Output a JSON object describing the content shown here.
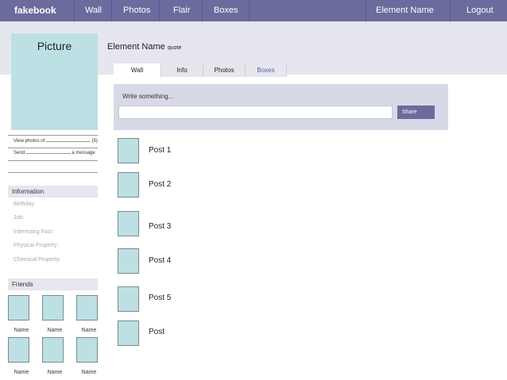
{
  "nav": {
    "logo": "fakebook",
    "wall": "Wall",
    "photos": "Photos",
    "flair": "Flair",
    "boxes": "Boxes",
    "element_name": "Element Name",
    "logout": "Logout"
  },
  "profile": {
    "picture_label": "Picture",
    "view_photos_prefix": "View photos of",
    "view_photos_count": "(5)",
    "send_prefix": "Send",
    "send_suffix": "a message"
  },
  "information": {
    "heading": "Information",
    "birthday": "Birthday:",
    "job": "Job:",
    "interesting_fact": "Interesting Fact:",
    "physical_property": "Physical Property:",
    "chemical_property": "Chemical Property:"
  },
  "friends": {
    "heading": "Friends",
    "names": [
      "Name",
      "Name",
      "Name",
      "Name",
      "Name",
      "Name"
    ]
  },
  "main": {
    "element_name": "Element Name",
    "quote": "quote",
    "tabs": [
      "Wall",
      "Info",
      "Photos",
      "Boxes"
    ],
    "composer_label": "Write something...",
    "composer_value": "",
    "share_label": "Share",
    "posts": [
      "Post 1",
      "Post 2",
      "Post 3",
      "Post 4",
      "Post 5",
      "Post"
    ]
  },
  "colors": {
    "nav_bg": "#6b6b9e",
    "band_bg": "#e6e6ee",
    "thumb_bg": "#bde0e4",
    "composer_bg": "#d8d9e6"
  }
}
